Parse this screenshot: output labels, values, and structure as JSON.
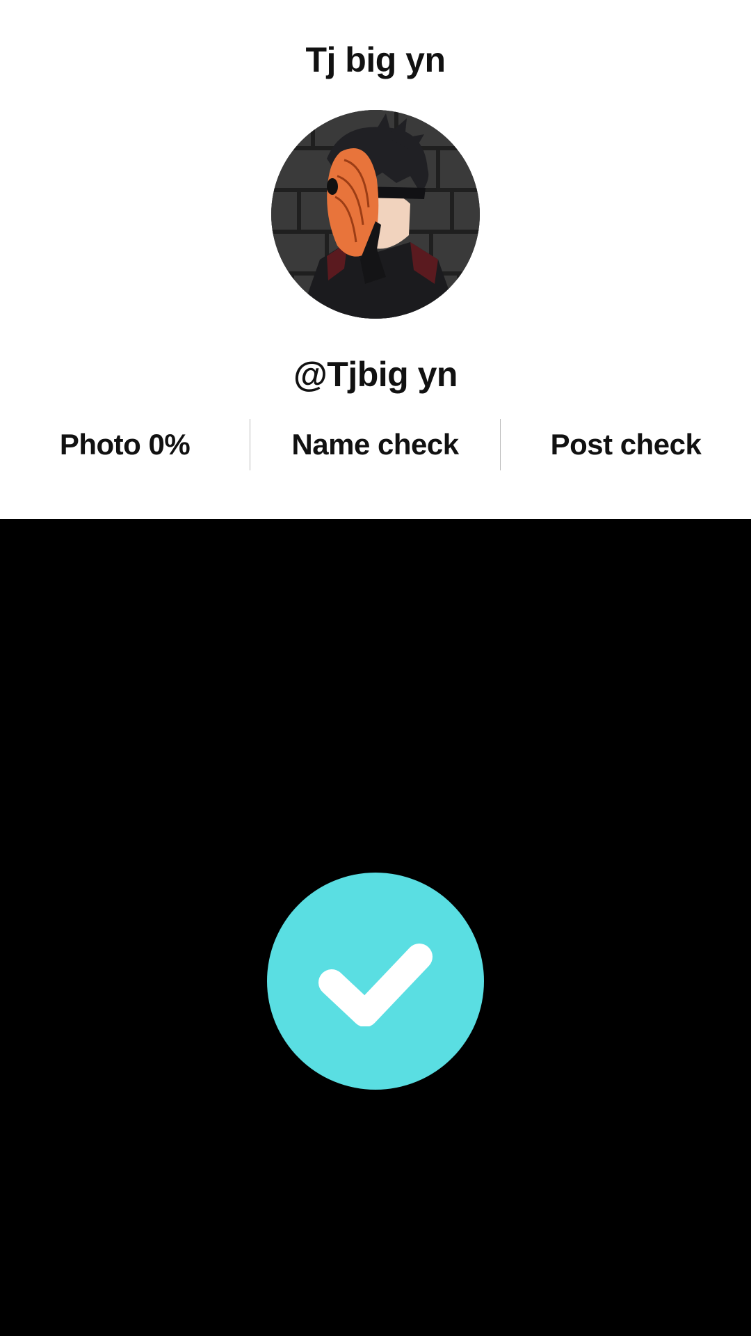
{
  "profile": {
    "display_name": "Tj big yn",
    "username": "@Tjbig yn",
    "avatar_icon": "avatar-anime-masked-character"
  },
  "stats": {
    "photo_label": "Photo 0%",
    "name_label": "Name check",
    "post_label": "Post check"
  },
  "badge": {
    "icon": "checkmark-icon",
    "color": "#5ADEE2"
  },
  "colors": {
    "card_background": "#FFFFFF",
    "page_background": "#000000",
    "text": "#111111"
  }
}
